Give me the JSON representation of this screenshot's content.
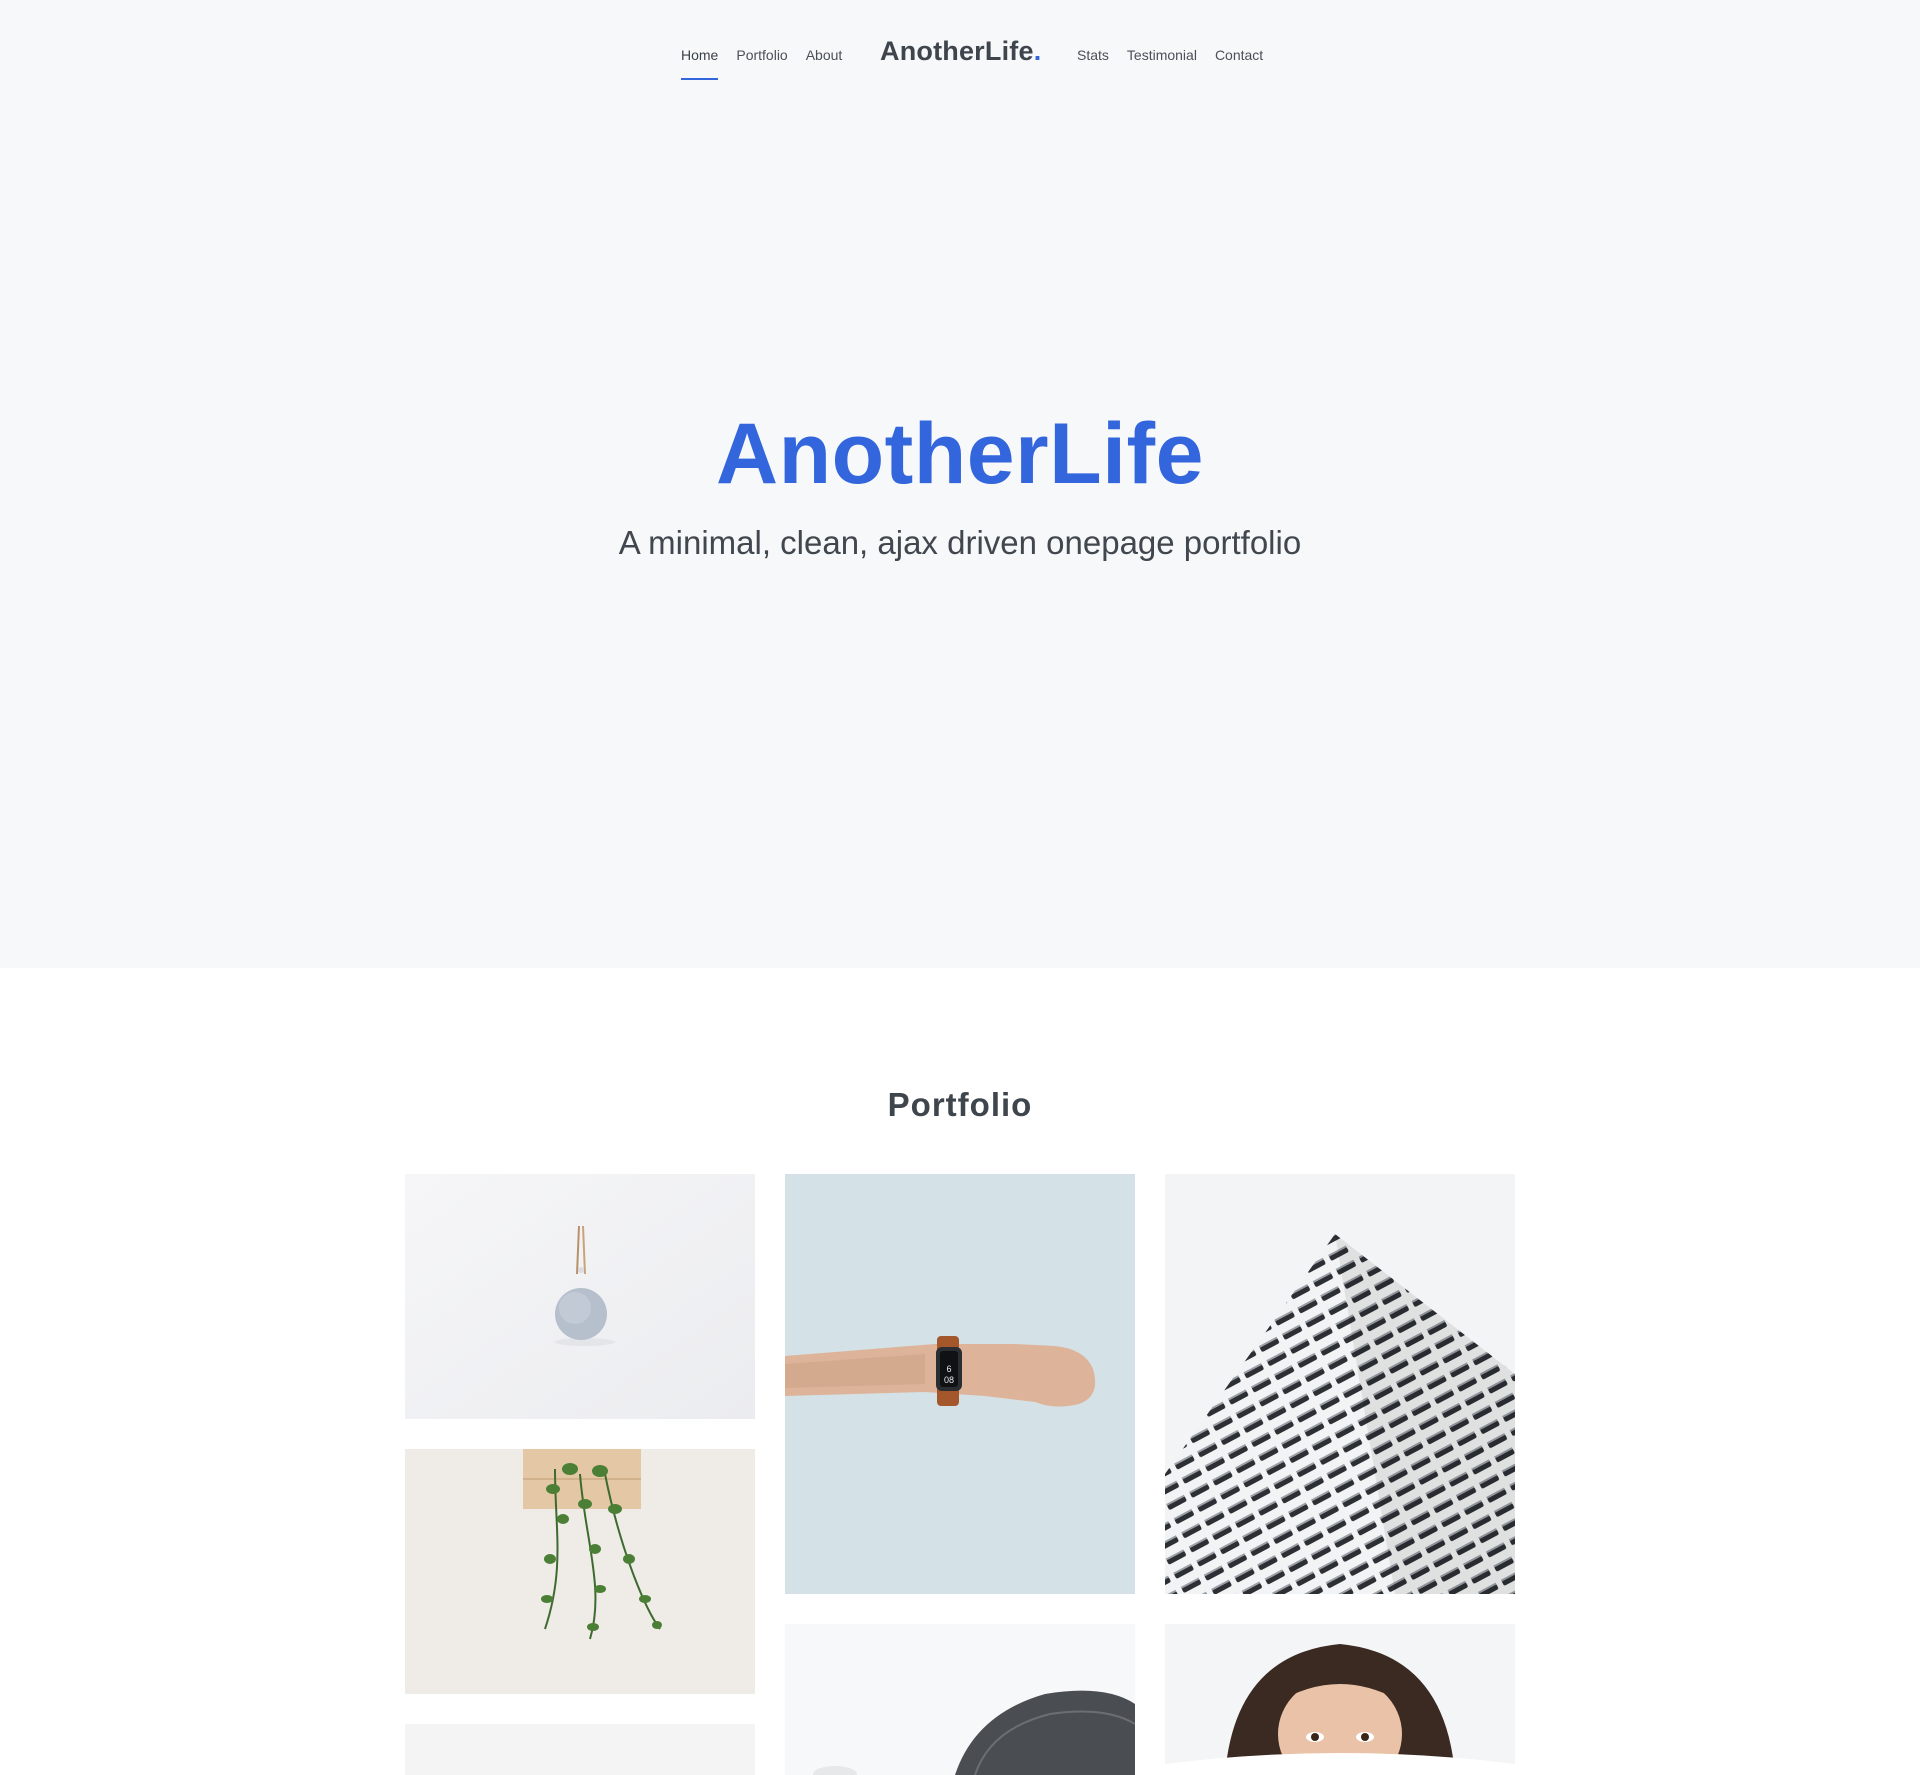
{
  "nav": {
    "left": [
      "Home",
      "Portfolio",
      "About"
    ],
    "brand": "AnotherLife",
    "brand_dot": ".",
    "right": [
      "Stats",
      "Testimonial",
      "Contact"
    ],
    "active": "Home",
    "accent_color": "#3366dd"
  },
  "hero": {
    "title": "AnotherLife",
    "subtitle": "A minimal, clean, ajax driven onepage portfolio"
  },
  "portfolio": {
    "title": "Portfolio",
    "items": [
      "pendant-ornament-image",
      "wristwatch-arm-image",
      "building-facade-image",
      "hanging-plant-image",
      "chair-image",
      "woman-peeking-image",
      "partial-tile-image"
    ]
  }
}
